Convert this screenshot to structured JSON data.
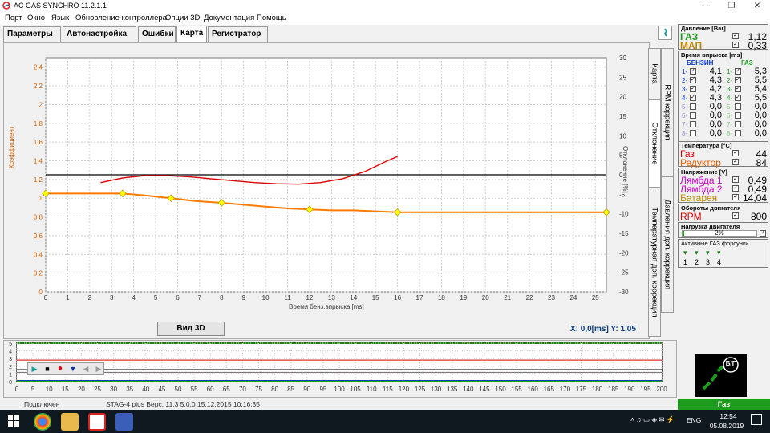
{
  "window": {
    "title": "AC GAS SYNCHRO  11.2.1.1",
    "minimize": "—",
    "restore": "❐",
    "close": "✕"
  },
  "menu": [
    "Порт",
    "Окно",
    "Язык",
    "Обновление контроллера",
    "Опции 3D",
    "Документация",
    "Помощь"
  ],
  "tabs": [
    "Параметры",
    "Автонастройка",
    "Ошибки",
    "Карта",
    "Регистратор"
  ],
  "side_tabs": [
    "Карта",
    "RPM коррекция",
    "Отклонение",
    "Температурная доп. коррекция",
    "Давления доп. коррекция"
  ],
  "main_chart_labels": {
    "xlabel": "Время бенз.впрыска [ms]",
    "ylabel_left": "Коэффициент",
    "ylabel_right": "Отклонение [%]"
  },
  "button_3d": "Вид 3D",
  "cursor": {
    "x_label": "X:",
    "x_value": "0,0[ms]",
    "y_label": "Y:",
    "y_value": "1,05"
  },
  "chart_data": [
    {
      "type": "line",
      "xlabel": "Время бенз.впрыска [ms]",
      "ylabel": "Коэффициент",
      "y2label": "Отклонение [%]",
      "xlim": [
        0,
        25.5
      ],
      "ylim": [
        0,
        2.5
      ],
      "y2lim": [
        -30,
        30
      ],
      "xticks": [
        0,
        1,
        2,
        3,
        4,
        5,
        6,
        7,
        8,
        9,
        10,
        11,
        12,
        13,
        14,
        15,
        16,
        17,
        18,
        19,
        20,
        21,
        22,
        23,
        24,
        25
      ],
      "yticks": [
        "0",
        "0,2",
        "0,4",
        "0,6",
        "0,8",
        "1",
        "1,2",
        "1,4",
        "1,6",
        "1,8",
        "2",
        "2,2",
        "2,4"
      ],
      "y2ticks": [
        -30,
        -25,
        -20,
        -15,
        -10,
        -5,
        0,
        5,
        10,
        15,
        20,
        25,
        30
      ],
      "grid": true,
      "series": [
        {
          "role": "coefficient",
          "color": "#ff7a00",
          "x": [
            0,
            2,
            3.5,
            4.5,
            5.7,
            6.8,
            8.0,
            9.0,
            10.0,
            11.0,
            12.0,
            13.0,
            14.0,
            15.0,
            16.0,
            18,
            20,
            22,
            24,
            25.5
          ],
          "y": [
            1.05,
            1.05,
            1.05,
            1.03,
            1.0,
            0.97,
            0.95,
            0.93,
            0.91,
            0.89,
            0.88,
            0.87,
            0.87,
            0.86,
            0.85,
            0.85,
            0.85,
            0.85,
            0.85,
            0.85
          ]
        },
        {
          "role": "deviation",
          "color": "#dd0000",
          "axis": "y2",
          "x": [
            2.5,
            3.5,
            4.5,
            5.5,
            6.5,
            7.5,
            8.5,
            9.5,
            10.5,
            11.5,
            12.5,
            13.5,
            14.5,
            15.5,
            16.0
          ],
          "y": [
            -2.0,
            -0.8,
            -0.2,
            -0.2,
            -0.5,
            -1.0,
            -1.5,
            -2.0,
            -2.3,
            -2.4,
            -2.0,
            -1.0,
            0.8,
            3.5,
            4.7
          ]
        }
      ],
      "control_points": [
        {
          "x": 0,
          "y": 1.05
        },
        {
          "x": 3.5,
          "y": 1.05
        },
        {
          "x": 5.7,
          "y": 1.0
        },
        {
          "x": 8.0,
          "y": 0.95
        },
        {
          "x": 12.0,
          "y": 0.88
        },
        {
          "x": 16.0,
          "y": 0.85
        },
        {
          "x": 25.5,
          "y": 0.85
        }
      ],
      "reference_line_y2": 0,
      "marker_color": "#ffff00"
    },
    {
      "type": "line",
      "title": "",
      "xticks": [
        0,
        5,
        10,
        15,
        20,
        25,
        30,
        35,
        40,
        45,
        50,
        55,
        60,
        65,
        70,
        75,
        80,
        85,
        90,
        95,
        100,
        105,
        110,
        115,
        120,
        125,
        130,
        135,
        140,
        145,
        150,
        155,
        160,
        165,
        170,
        175,
        180,
        185,
        190,
        195,
        200
      ],
      "yticks": [
        0,
        1,
        2,
        3,
        4,
        5
      ],
      "xlim": [
        0,
        200
      ],
      "ylim": [
        0,
        5
      ],
      "series": [
        {
          "color": "#7a7a7a",
          "y_level": 1.2
        },
        {
          "color": "#7a7a7a",
          "y_level": 1.6
        },
        {
          "color": "#dd3333",
          "y_level": 2.8
        },
        {
          "color": "#0033cc",
          "y_level": 0.15
        },
        {
          "color": "#1c9e1c",
          "y_level": 0.05
        }
      ]
    }
  ],
  "recorder_buttons": [
    "play-icon",
    "stop-icon",
    "record-icon",
    "trigger-icon",
    "prev-icon",
    "next-icon"
  ],
  "pressure": {
    "title": "Давление [Bar]",
    "rows": [
      {
        "label": "ГАЗ",
        "value": "1,12",
        "color": "#1c9e1c"
      },
      {
        "label": "МАП",
        "value": "0,33",
        "color": "#c08a00"
      }
    ]
  },
  "injection": {
    "title": "Время впрыска [ms]",
    "petrol_header": "БЕНЗИН",
    "gas_header": "ГАЗ",
    "petrol": [
      {
        "n": "1",
        "value": "4,1"
      },
      {
        "n": "2",
        "value": "4,3"
      },
      {
        "n": "3",
        "value": "4,2"
      },
      {
        "n": "4",
        "value": "4,3"
      },
      {
        "n": "5",
        "value": "0,0"
      },
      {
        "n": "6",
        "value": "0,0"
      },
      {
        "n": "7",
        "value": "0,0"
      },
      {
        "n": "8",
        "value": "0,0"
      }
    ],
    "gas": [
      {
        "n": "1",
        "value": "5,3"
      },
      {
        "n": "2",
        "value": "5,5"
      },
      {
        "n": "3",
        "value": "5,4"
      },
      {
        "n": "4",
        "value": "5,5"
      },
      {
        "n": "5",
        "value": "0,0"
      },
      {
        "n": "6",
        "value": "0,0"
      },
      {
        "n": "7",
        "value": "0,0"
      },
      {
        "n": "8",
        "value": "0,0"
      }
    ]
  },
  "temperature": {
    "title": "Температура [°C]",
    "rows": [
      {
        "label": "Газ",
        "value": "44",
        "color": "#dd0000"
      },
      {
        "label": "Редуктор",
        "value": "84",
        "color": "#e06000"
      }
    ]
  },
  "voltage": {
    "title": "Напряжение [V]",
    "rows": [
      {
        "label": "Лямбда 1",
        "value": "0,49",
        "color": "#d000d0"
      },
      {
        "label": "Лямбда 2",
        "value": "0,49",
        "color": "#d000d0"
      },
      {
        "label": "Батарея",
        "value": "14,04",
        "color": "#c08a00"
      }
    ]
  },
  "rpm": {
    "title": "Обороты двигателя",
    "label": "RPM",
    "value": "800",
    "color": "#dd0000"
  },
  "load": {
    "title": "Нагрузка двигателя",
    "value": "2%"
  },
  "active_injectors": {
    "title": "Активные ГАЗ форсунки",
    "numbers": [
      "1",
      "2",
      "3",
      "4"
    ]
  },
  "status": {
    "connection": "Подключен",
    "device": "STAG-4 plus   Верс. 11.3  5.0.0    15.12.2015 10:16:35"
  },
  "fuel_mode": {
    "icon_label": "Б/Г",
    "state": "Газ"
  },
  "taskbar": {
    "lang": "ENG",
    "time": "12:54",
    "date": "05.08.2019"
  },
  "colors": {
    "gas_green": "#1c9e1c",
    "accent_orange": "#ff7a00",
    "deviation_red": "#dd0000",
    "marker_yellow": "#ffff00"
  }
}
